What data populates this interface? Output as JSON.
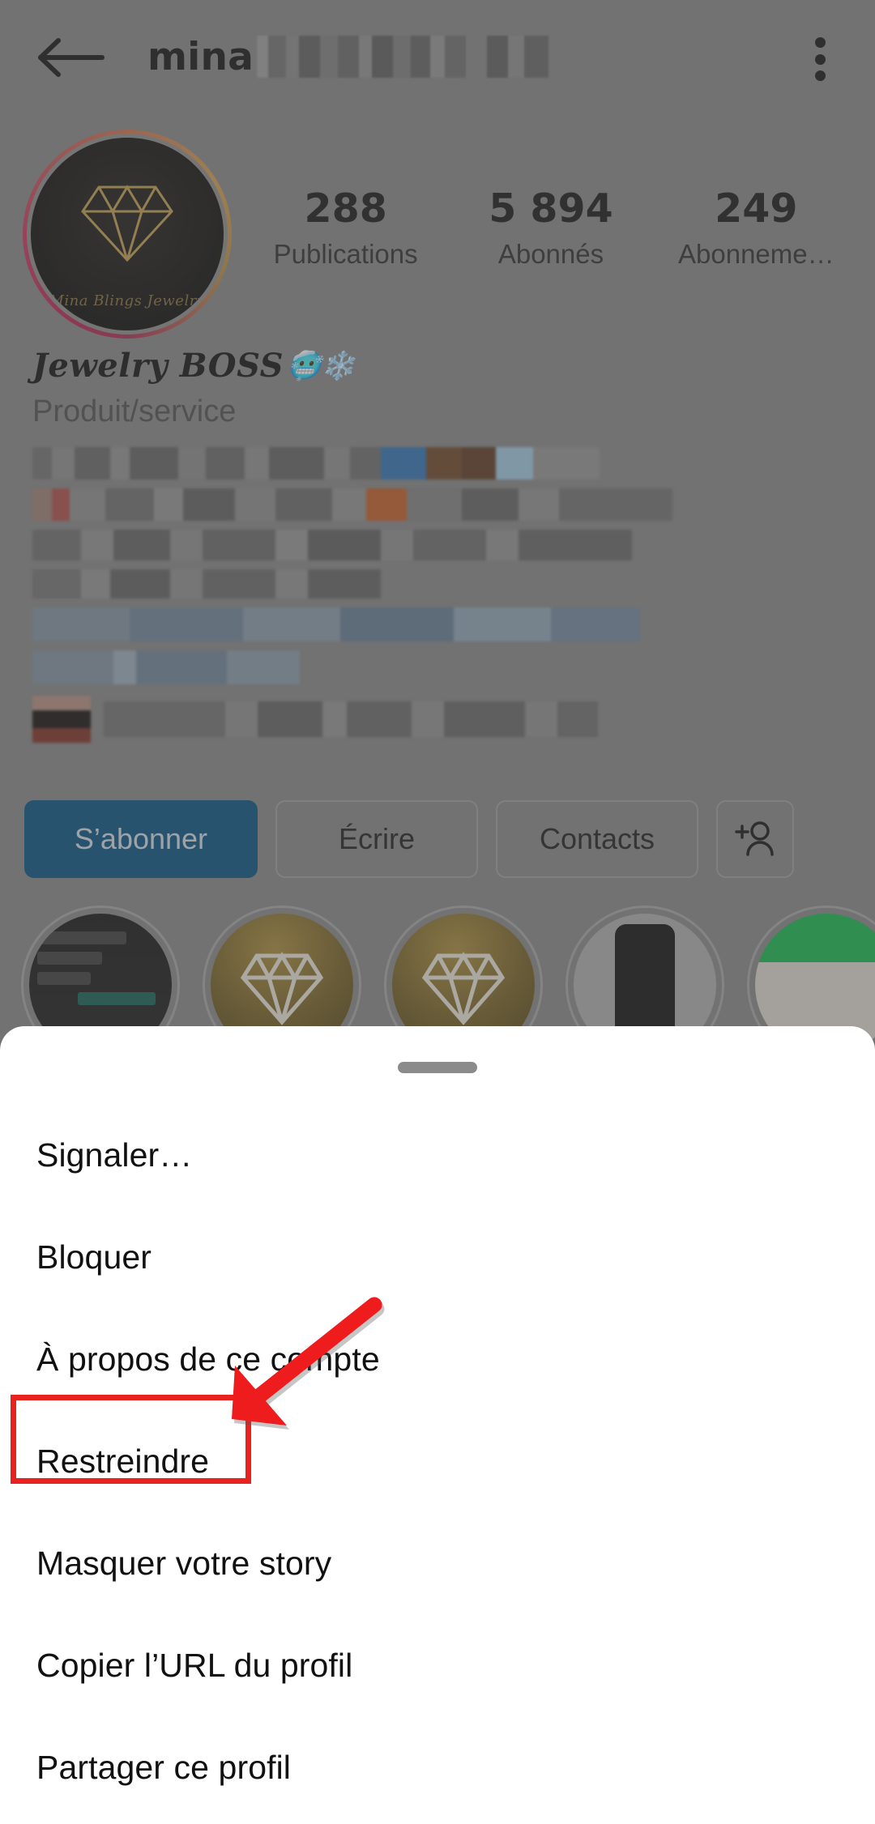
{
  "appbar": {
    "back_icon": "back-arrow-icon",
    "username": "mina",
    "username_censored": true,
    "overflow_icon": "three-dot-menu-icon"
  },
  "profile": {
    "avatar_caption": "Mina Blings Jewelry",
    "avatar_icon": "diamond-icon",
    "has_story_ring": true,
    "stats": [
      {
        "value": "288",
        "label": "Publications"
      },
      {
        "value": "5 894",
        "label": "Abonnés"
      },
      {
        "value": "249",
        "label": "Abonneme…"
      }
    ],
    "bio_title": "Jewelry BOSS",
    "bio_emoji": "🥶❄️",
    "bio_category": "Produit/service",
    "bio_body_censored": true,
    "actions": [
      {
        "label": "S’abonner",
        "name": "follow-button",
        "primary": true
      },
      {
        "label": "Écrire",
        "name": "message-button",
        "primary": false
      },
      {
        "label": "Contacts",
        "name": "contact-button",
        "primary": false
      },
      {
        "label": "",
        "name": "add-user-button",
        "icon": "add-person-icon",
        "primary": false
      }
    ],
    "highlights_count": 5
  },
  "sheet": {
    "handle": "drag-handle",
    "items": [
      {
        "label": "Signaler…",
        "name": "menu-item-report"
      },
      {
        "label": "Bloquer",
        "name": "menu-item-block"
      },
      {
        "label": "À propos de ce compte",
        "name": "menu-item-about-account"
      },
      {
        "label": "Restreindre",
        "name": "menu-item-restrict"
      },
      {
        "label": "Masquer votre story",
        "name": "menu-item-hide-story"
      },
      {
        "label": "Copier l’URL du profil",
        "name": "menu-item-copy-url"
      },
      {
        "label": "Partager ce profil",
        "name": "menu-item-share-profile"
      }
    ]
  },
  "annotation": {
    "highlighted_item": "Restreindre",
    "box_color": "#e8231f",
    "arrow_color": "#ee1c1c"
  },
  "colors": {
    "scrim": "#838383",
    "sheet_background": "#ffffff",
    "primary_button": "#044e7f",
    "text": "#111111",
    "muted_text": "#4d4d4d",
    "story_ring_start": "#b3204f",
    "story_ring_end": "#cf9a4e"
  }
}
